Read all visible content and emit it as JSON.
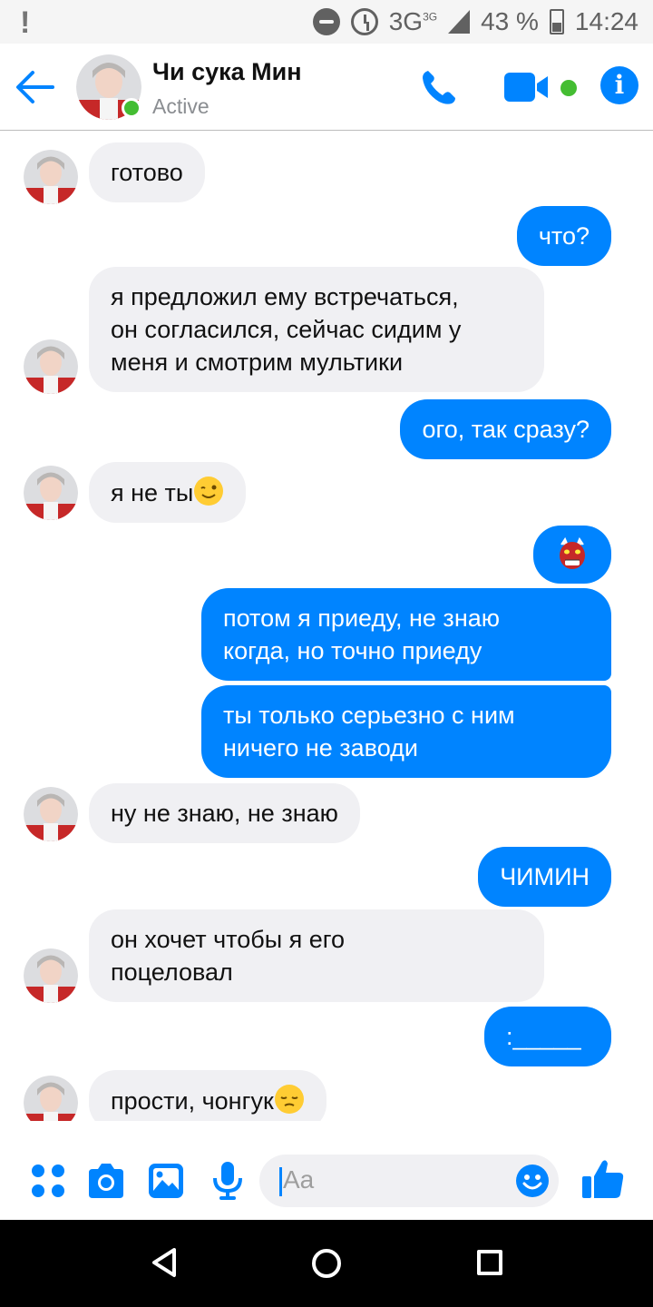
{
  "status_bar": {
    "network": "3G",
    "network_sup": "3G",
    "battery": "43 %",
    "time": "14:24"
  },
  "header": {
    "contact_name": "Чи сука Мин",
    "status": "Active"
  },
  "messages": [
    {
      "side": "in",
      "text": "готово"
    },
    {
      "side": "out",
      "text": "что?"
    },
    {
      "side": "in",
      "text": "я предложил ему встречаться,\nон согласился, сейчас сидим у\nменя и смотрим мультики"
    },
    {
      "side": "out",
      "text": "ого, так сразу?"
    },
    {
      "side": "in",
      "text": "я не ты",
      "emoji": "winking-face"
    },
    {
      "side": "out",
      "text": "",
      "emoji": "red-ogre-mask"
    },
    {
      "side": "out",
      "text": "потом я приеду, не знаю\nкогда, но точно приеду"
    },
    {
      "side": "out",
      "text": "ты только серьезно с ним\nничего не заводи"
    },
    {
      "side": "in",
      "text": "ну не знаю, не знаю"
    },
    {
      "side": "out",
      "text": "ЧИМИН"
    },
    {
      "side": "in",
      "text": "он хочет чтобы я его\nпоцеловал"
    },
    {
      "side": "out",
      "text": ":_____"
    },
    {
      "side": "in",
      "text": "прости, чонгук",
      "emoji": "pensive-face"
    }
  ],
  "composer": {
    "placeholder": "Aa"
  },
  "colors": {
    "accent": "#0084ff",
    "online": "#44bd32",
    "incoming_bubble": "#f0f0f3"
  }
}
